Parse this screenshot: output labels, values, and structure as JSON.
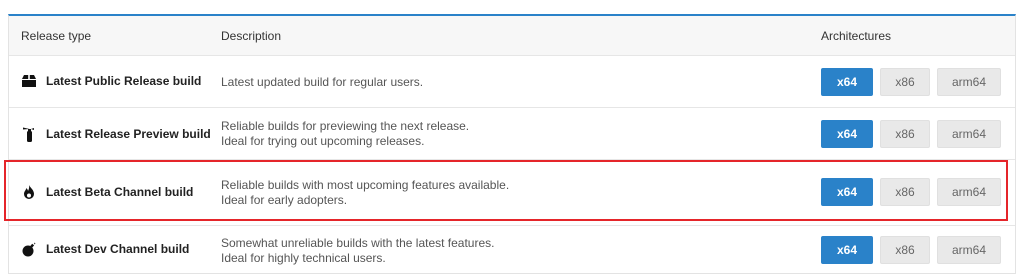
{
  "header": {
    "release_type": "Release type",
    "description": "Description",
    "architectures": "Architectures"
  },
  "colors": {
    "accent": "#2a82c9",
    "highlight": "#e5252a"
  },
  "rows": [
    {
      "icon": "package-icon",
      "name": "Latest Public Release build",
      "desc1": "Latest updated build for regular users.",
      "desc2": ""
    },
    {
      "icon": "fire-extinguisher-icon",
      "name": "Latest Release Preview build",
      "desc1": "Reliable builds for previewing the next release.",
      "desc2": "Ideal for trying out upcoming releases."
    },
    {
      "icon": "flame-icon",
      "name": "Latest Beta Channel build",
      "desc1": "Reliable builds with most upcoming features available.",
      "desc2": "Ideal for early adopters."
    },
    {
      "icon": "bomb-icon",
      "name": "Latest Dev Channel build",
      "desc1": "Somewhat unreliable builds with the latest features.",
      "desc2": "Ideal for highly technical users."
    }
  ],
  "arch": {
    "x64": "x64",
    "x86": "x86",
    "arm64": "arm64",
    "selected": "x64"
  }
}
